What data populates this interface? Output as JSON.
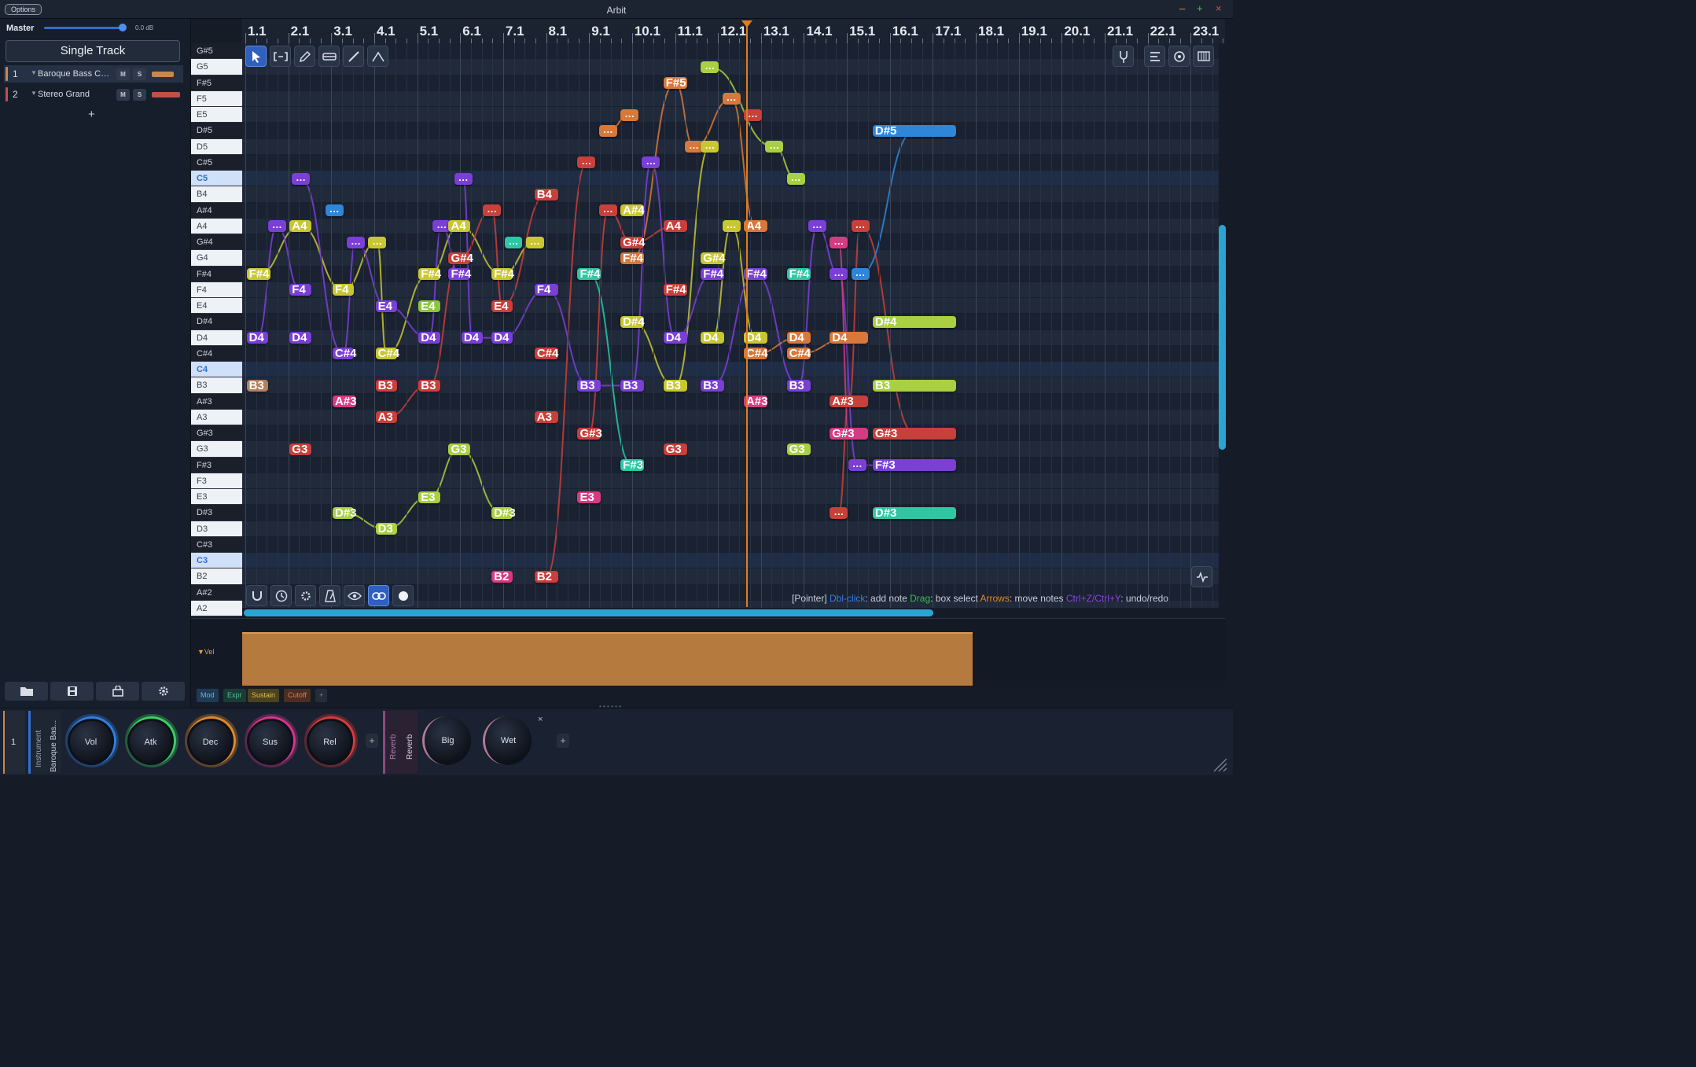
{
  "app": {
    "title": "Arbit",
    "options_label": "Options",
    "minimize": "–",
    "maximize": "+",
    "close": "×"
  },
  "master": {
    "label": "Master",
    "db": "0.0 dB",
    "level": 0.95
  },
  "mode_button": "Single Track",
  "tracks": [
    {
      "num": "1",
      "name": "Baroque Bass Continuo",
      "color": "#c9884e",
      "mute": "M",
      "solo": "S",
      "selected": true
    },
    {
      "num": "2",
      "name": "Stereo Grand",
      "color": "#c0504a",
      "mute": "M",
      "solo": "S",
      "selected": false
    }
  ],
  "add_track": "+",
  "bars": [
    "1.1",
    "2.1",
    "3.1",
    "4.1",
    "5.1",
    "6.1",
    "7.1",
    "8.1",
    "9.1",
    "10.1",
    "11.1",
    "12.1",
    "13.1",
    "14.1",
    "15.1",
    "16.1",
    "17.1",
    "18.1",
    "19.1",
    "20.1",
    "21.1",
    "22.1",
    "23.1"
  ],
  "keys": [
    "G#5",
    "G5",
    "F#5",
    "F5",
    "E5",
    "D#5",
    "D5",
    "C#5",
    "C5",
    "B4",
    "A#4",
    "A4",
    "G#4",
    "G4",
    "F#4",
    "F4",
    "E4",
    "D#4",
    "D4",
    "C#4",
    "C4",
    "B3",
    "A#3",
    "A3",
    "G#3",
    "G3",
    "F#3",
    "F3",
    "E3",
    "D#3",
    "D3",
    "C#3",
    "C3",
    "B2",
    "A#2",
    "A2"
  ],
  "colors": {
    "purple": "#7b3fd6",
    "yellow": "#c9c730",
    "tan": "#b8805a",
    "red": "#c8403a",
    "orange": "#d8783a",
    "blue": "#2f86d8",
    "green": "#8bc63a",
    "teal": "#2ec7a4",
    "pink": "#d63b82",
    "lime": "#a8d040"
  },
  "notes": [
    {
      "label": "F#4",
      "bar": 1.03,
      "len": 0.55,
      "key": "F#4",
      "color": "yellow"
    },
    {
      "label": "D4",
      "bar": 1.03,
      "len": 0.5,
      "key": "D4",
      "color": "purple"
    },
    {
      "label": "B3",
      "bar": 1.03,
      "len": 0.5,
      "key": "B3",
      "color": "tan"
    },
    {
      "label": "…",
      "bar": 1.53,
      "len": 0.42,
      "key": "A4",
      "color": "purple"
    },
    {
      "label": "A4",
      "bar": 2.03,
      "len": 0.5,
      "key": "A4",
      "color": "yellow"
    },
    {
      "label": "…",
      "bar": 2.08,
      "len": 0.42,
      "key": "C5",
      "color": "purple"
    },
    {
      "label": "F4",
      "bar": 2.03,
      "len": 0.5,
      "key": "F4",
      "color": "purple"
    },
    {
      "label": "D4",
      "bar": 2.03,
      "len": 0.5,
      "key": "D4",
      "color": "purple"
    },
    {
      "label": "G3",
      "bar": 2.03,
      "len": 0.5,
      "key": "G3",
      "color": "red"
    },
    {
      "label": "…",
      "bar": 2.86,
      "len": 0.42,
      "key": "A#4",
      "color": "blue"
    },
    {
      "label": "F4",
      "bar": 3.03,
      "len": 0.5,
      "key": "F4",
      "color": "yellow"
    },
    {
      "label": "…",
      "bar": 3.36,
      "len": 0.42,
      "key": "G#4",
      "color": "purple"
    },
    {
      "label": "C#4",
      "bar": 3.03,
      "len": 0.5,
      "key": "C#4",
      "color": "purple"
    },
    {
      "label": "A#3",
      "bar": 3.03,
      "len": 0.55,
      "key": "A#3",
      "color": "pink"
    },
    {
      "label": "D#3",
      "bar": 3.03,
      "len": 0.5,
      "key": "D#3",
      "color": "lime"
    },
    {
      "label": "…",
      "bar": 3.86,
      "len": 0.42,
      "key": "G#4",
      "color": "yellow"
    },
    {
      "label": "E4",
      "bar": 4.03,
      "len": 0.5,
      "key": "E4",
      "color": "purple"
    },
    {
      "label": "C#4",
      "bar": 4.03,
      "len": 0.5,
      "key": "C#4",
      "color": "yellow"
    },
    {
      "label": "B3",
      "bar": 4.03,
      "len": 0.5,
      "key": "B3",
      "color": "red"
    },
    {
      "label": "A3",
      "bar": 4.03,
      "len": 0.5,
      "key": "A3",
      "color": "red"
    },
    {
      "label": "D3",
      "bar": 4.03,
      "len": 0.5,
      "key": "D3",
      "color": "lime"
    },
    {
      "label": "F#4",
      "bar": 5.03,
      "len": 0.5,
      "key": "F#4",
      "color": "yellow"
    },
    {
      "label": "E4",
      "bar": 5.03,
      "len": 0.5,
      "key": "E4",
      "color": "green"
    },
    {
      "label": "D4",
      "bar": 5.03,
      "len": 0.5,
      "key": "D4",
      "color": "purple"
    },
    {
      "label": "B3",
      "bar": 5.03,
      "len": 0.5,
      "key": "B3",
      "color": "red"
    },
    {
      "label": "E3",
      "bar": 5.03,
      "len": 0.5,
      "key": "E3",
      "color": "lime"
    },
    {
      "label": "…",
      "bar": 5.36,
      "len": 0.42,
      "key": "A4",
      "color": "purple"
    },
    {
      "label": "A4",
      "bar": 5.73,
      "len": 0.5,
      "key": "A4",
      "color": "yellow"
    },
    {
      "label": "…",
      "bar": 5.86,
      "len": 0.42,
      "key": "C5",
      "color": "purple"
    },
    {
      "label": "G#4",
      "bar": 5.73,
      "len": 0.5,
      "key": "G4",
      "color": "red"
    },
    {
      "label": "F#4",
      "bar": 5.73,
      "len": 0.5,
      "key": "F#4",
      "color": "purple"
    },
    {
      "label": "D4",
      "bar": 6.03,
      "len": 0.5,
      "key": "D4",
      "color": "purple"
    },
    {
      "label": "G3",
      "bar": 5.73,
      "len": 0.5,
      "key": "G3",
      "color": "lime"
    },
    {
      "label": "…",
      "bar": 6.53,
      "len": 0.42,
      "key": "A#4",
      "color": "red"
    },
    {
      "label": "F#4",
      "bar": 6.73,
      "len": 0.5,
      "key": "F#4",
      "color": "yellow"
    },
    {
      "label": "…",
      "bar": 7.03,
      "len": 0.42,
      "key": "G#4",
      "color": "teal"
    },
    {
      "label": "E4",
      "bar": 6.73,
      "len": 0.5,
      "key": "E4",
      "color": "red"
    },
    {
      "label": "D4",
      "bar": 6.73,
      "len": 0.5,
      "key": "D4",
      "color": "purple"
    },
    {
      "label": "D#3",
      "bar": 6.73,
      "len": 0.5,
      "key": "D#3",
      "color": "lime"
    },
    {
      "label": "B2",
      "bar": 6.73,
      "len": 0.5,
      "key": "B2",
      "color": "pink"
    },
    {
      "label": "…",
      "bar": 7.53,
      "len": 0.42,
      "key": "G#4",
      "color": "yellow"
    },
    {
      "label": "B4",
      "bar": 7.73,
      "len": 0.55,
      "key": "B4",
      "color": "red"
    },
    {
      "label": "F4",
      "bar": 7.73,
      "len": 0.55,
      "key": "F4",
      "color": "purple"
    },
    {
      "label": "C#4",
      "bar": 7.73,
      "len": 0.55,
      "key": "C#4",
      "color": "red"
    },
    {
      "label": "A3",
      "bar": 7.73,
      "len": 0.55,
      "key": "A3",
      "color": "red"
    },
    {
      "label": "B2",
      "bar": 7.73,
      "len": 0.55,
      "key": "B2",
      "color": "red"
    },
    {
      "label": "…",
      "bar": 8.73,
      "len": 0.42,
      "key": "C#5",
      "color": "red"
    },
    {
      "label": "…",
      "bar": 9.23,
      "len": 0.42,
      "key": "D#5",
      "color": "orange"
    },
    {
      "label": "…",
      "bar": 9.23,
      "len": 0.42,
      "key": "A#4",
      "color": "red"
    },
    {
      "label": "F#4",
      "bar": 8.73,
      "len": 0.55,
      "key": "F#4",
      "color": "teal"
    },
    {
      "label": "B3",
      "bar": 8.73,
      "len": 0.55,
      "key": "B3",
      "color": "purple"
    },
    {
      "label": "G#3",
      "bar": 8.73,
      "len": 0.55,
      "key": "G#3",
      "color": "red"
    },
    {
      "label": "E3",
      "bar": 8.73,
      "len": 0.55,
      "key": "E3",
      "color": "pink"
    },
    {
      "label": "…",
      "bar": 9.73,
      "len": 0.42,
      "key": "E5",
      "color": "orange"
    },
    {
      "label": "…",
      "bar": 10.23,
      "len": 0.42,
      "key": "C#5",
      "color": "purple"
    },
    {
      "label": "A#4",
      "bar": 9.73,
      "len": 0.55,
      "key": "A#4",
      "color": "yellow"
    },
    {
      "label": "G#4",
      "bar": 9.73,
      "len": 0.55,
      "key": "G#4",
      "color": "red"
    },
    {
      "label": "F#4",
      "bar": 9.73,
      "len": 0.55,
      "key": "G4",
      "color": "orange"
    },
    {
      "label": "D#4",
      "bar": 9.73,
      "len": 0.55,
      "key": "D#4",
      "color": "yellow"
    },
    {
      "label": "B3",
      "bar": 9.73,
      "len": 0.55,
      "key": "B3",
      "color": "purple"
    },
    {
      "label": "F#3",
      "bar": 9.73,
      "len": 0.55,
      "key": "F#3",
      "color": "teal"
    },
    {
      "label": "F#5",
      "bar": 10.73,
      "len": 0.55,
      "key": "F#5",
      "color": "orange"
    },
    {
      "label": "A4",
      "bar": 10.73,
      "len": 0.55,
      "key": "A4",
      "color": "red"
    },
    {
      "label": "F#4",
      "bar": 10.73,
      "len": 0.55,
      "key": "F4",
      "color": "red"
    },
    {
      "label": "D4",
      "bar": 10.73,
      "len": 0.55,
      "key": "D4",
      "color": "purple"
    },
    {
      "label": "B3",
      "bar": 10.73,
      "len": 0.55,
      "key": "B3",
      "color": "yellow"
    },
    {
      "label": "G3",
      "bar": 10.73,
      "len": 0.55,
      "key": "G3",
      "color": "red"
    },
    {
      "label": "…",
      "bar": 11.23,
      "len": 0.42,
      "key": "D5",
      "color": "orange"
    },
    {
      "label": "…",
      "bar": 11.6,
      "len": 0.42,
      "key": "G5",
      "color": "lime"
    },
    {
      "label": "…",
      "bar": 11.6,
      "len": 0.42,
      "key": "D5",
      "color": "yellow"
    },
    {
      "label": "G#4",
      "bar": 11.6,
      "len": 0.55,
      "key": "G4",
      "color": "yellow"
    },
    {
      "label": "F#4",
      "bar": 11.6,
      "len": 0.55,
      "key": "F#4",
      "color": "purple"
    },
    {
      "label": "D4",
      "bar": 11.6,
      "len": 0.55,
      "key": "D4",
      "color": "yellow"
    },
    {
      "label": "B3",
      "bar": 11.6,
      "len": 0.55,
      "key": "B3",
      "color": "purple"
    },
    {
      "label": "…",
      "bar": 12.1,
      "len": 0.42,
      "key": "F5",
      "color": "orange"
    },
    {
      "label": "…",
      "bar": 12.1,
      "len": 0.42,
      "key": "A4",
      "color": "yellow"
    },
    {
      "label": "…",
      "bar": 12.6,
      "len": 0.42,
      "key": "E5",
      "color": "red"
    },
    {
      "label": "A4",
      "bar": 12.6,
      "len": 0.55,
      "key": "A4",
      "color": "orange"
    },
    {
      "label": "F#4",
      "bar": 12.6,
      "len": 0.55,
      "key": "F#4",
      "color": "purple"
    },
    {
      "label": "D4",
      "bar": 12.6,
      "len": 0.55,
      "key": "D4",
      "color": "yellow"
    },
    {
      "label": "C#4",
      "bar": 12.6,
      "len": 0.55,
      "key": "C#4",
      "color": "orange"
    },
    {
      "label": "A#3",
      "bar": 12.6,
      "len": 0.55,
      "key": "A#3",
      "color": "pink"
    },
    {
      "label": "…",
      "bar": 13.1,
      "len": 0.42,
      "key": "D5",
      "color": "lime"
    },
    {
      "label": "…",
      "bar": 13.6,
      "len": 0.42,
      "key": "C5",
      "color": "lime"
    },
    {
      "label": "F#4",
      "bar": 13.6,
      "len": 0.55,
      "key": "F#4",
      "color": "teal"
    },
    {
      "label": "D4",
      "bar": 13.6,
      "len": 0.55,
      "key": "D4",
      "color": "orange"
    },
    {
      "label": "C#4",
      "bar": 13.6,
      "len": 0.55,
      "key": "C#4",
      "color": "orange"
    },
    {
      "label": "B3",
      "bar": 13.6,
      "len": 0.55,
      "key": "B3",
      "color": "purple"
    },
    {
      "label": "G3",
      "bar": 13.6,
      "len": 0.55,
      "key": "G3",
      "color": "lime"
    },
    {
      "label": "…",
      "bar": 14.1,
      "len": 0.42,
      "key": "A4",
      "color": "purple"
    },
    {
      "label": "…",
      "bar": 14.6,
      "len": 0.42,
      "key": "G#4",
      "color": "pink"
    },
    {
      "label": "…",
      "bar": 15.1,
      "len": 0.42,
      "key": "A4",
      "color": "red"
    },
    {
      "label": "…",
      "bar": 14.6,
      "len": 0.42,
      "key": "F#4",
      "color": "purple"
    },
    {
      "label": "…",
      "bar": 15.1,
      "len": 0.42,
      "key": "F#4",
      "color": "blue"
    },
    {
      "label": "D4",
      "bar": 14.6,
      "len": 0.9,
      "key": "D4",
      "color": "orange"
    },
    {
      "label": "A#3",
      "bar": 14.6,
      "len": 0.9,
      "key": "A#3",
      "color": "red"
    },
    {
      "label": "G#3",
      "bar": 14.6,
      "len": 0.9,
      "key": "G#3",
      "color": "pink"
    },
    {
      "label": "…",
      "bar": 15.03,
      "len": 0.42,
      "key": "F#3",
      "color": "purple"
    },
    {
      "label": "…",
      "bar": 14.6,
      "len": 0.42,
      "key": "D#3",
      "color": "red"
    },
    {
      "label": "D#5",
      "bar": 15.6,
      "len": 1.95,
      "key": "D#5",
      "color": "blue"
    },
    {
      "label": "D#4",
      "bar": 15.6,
      "len": 1.95,
      "key": "D#4",
      "color": "lime"
    },
    {
      "label": "B3",
      "bar": 15.6,
      "len": 1.95,
      "key": "B3",
      "color": "lime"
    },
    {
      "label": "G#3",
      "bar": 15.6,
      "len": 1.95,
      "key": "G#3",
      "color": "red"
    },
    {
      "label": "F#3",
      "bar": 15.6,
      "len": 1.95,
      "key": "F#3",
      "color": "purple"
    },
    {
      "label": "D#3",
      "bar": 15.6,
      "len": 1.95,
      "key": "D#3",
      "color": "teal"
    }
  ],
  "hint": {
    "mode": "[Pointer]",
    "k1": "Dbl-click",
    "v1": ": add note",
    "k2": "Drag",
    "v2": ": box select",
    "k3": "Arrows",
    "v3": ": move notes",
    "k4": "Ctrl+Z/Ctrl+Y",
    "v4": ": undo/redo"
  },
  "velocity": {
    "label": "Vel"
  },
  "cc_tabs": [
    "Mod",
    "Expr",
    "Sustain",
    "Cutoff",
    "+"
  ],
  "rack": {
    "track_num": "1",
    "instrument_label": "Instrument",
    "instrument_name": "Baroque Bas...",
    "knobs": [
      "Vol",
      "Atk",
      "Dec",
      "Sus",
      "Rel"
    ],
    "add": "+",
    "fx_label": "Reverb",
    "fx_name": "Reverb",
    "fx_knobs": [
      "Big",
      "Wet"
    ],
    "fx_close": "×",
    "add2": "+"
  }
}
